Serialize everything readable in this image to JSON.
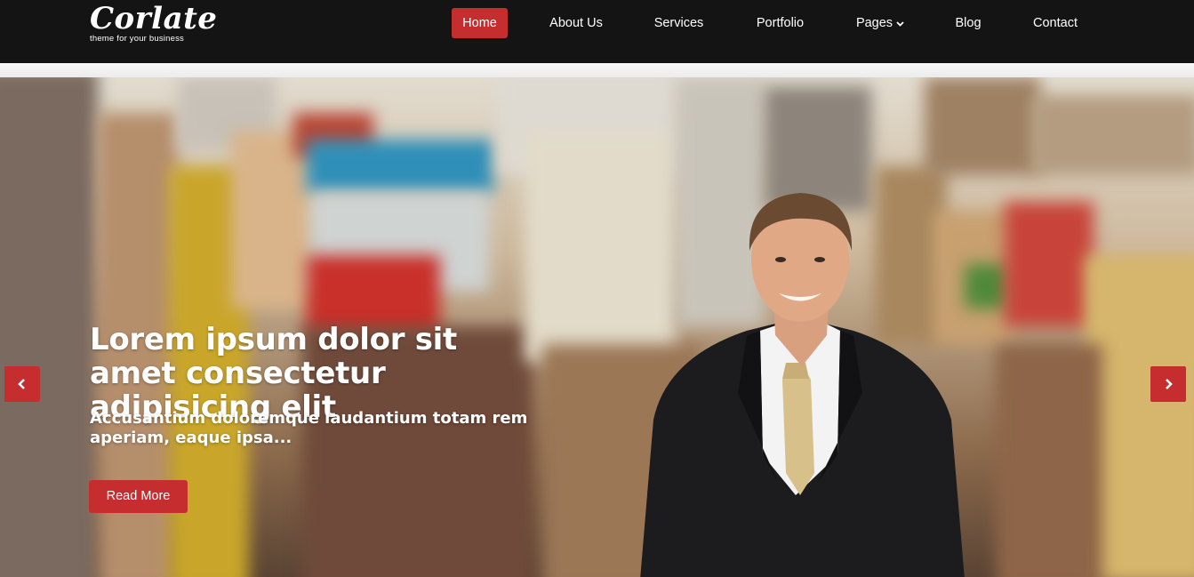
{
  "logo": {
    "name": "Corlate",
    "tagline": "theme for your business"
  },
  "nav": {
    "items": [
      {
        "label": "Home",
        "active": true
      },
      {
        "label": "About Us",
        "active": false
      },
      {
        "label": "Services",
        "active": false
      },
      {
        "label": "Portfolio",
        "active": false
      },
      {
        "label": "Pages",
        "active": false,
        "dropdown": true
      },
      {
        "label": "Blog",
        "active": false
      },
      {
        "label": "Contact",
        "active": false
      }
    ]
  },
  "hero": {
    "title": "Lorem ipsum dolor sit amet consectetur adipisicing elit",
    "subtitle": "Accusantium doloremque laudantium totam rem aperiam, eaque ipsa...",
    "button_label": "Read More",
    "prev_icon": "chevron-left-icon",
    "next_icon": "chevron-right-icon"
  },
  "colors": {
    "accent": "#c52d2f",
    "header_bg": "#141414"
  }
}
